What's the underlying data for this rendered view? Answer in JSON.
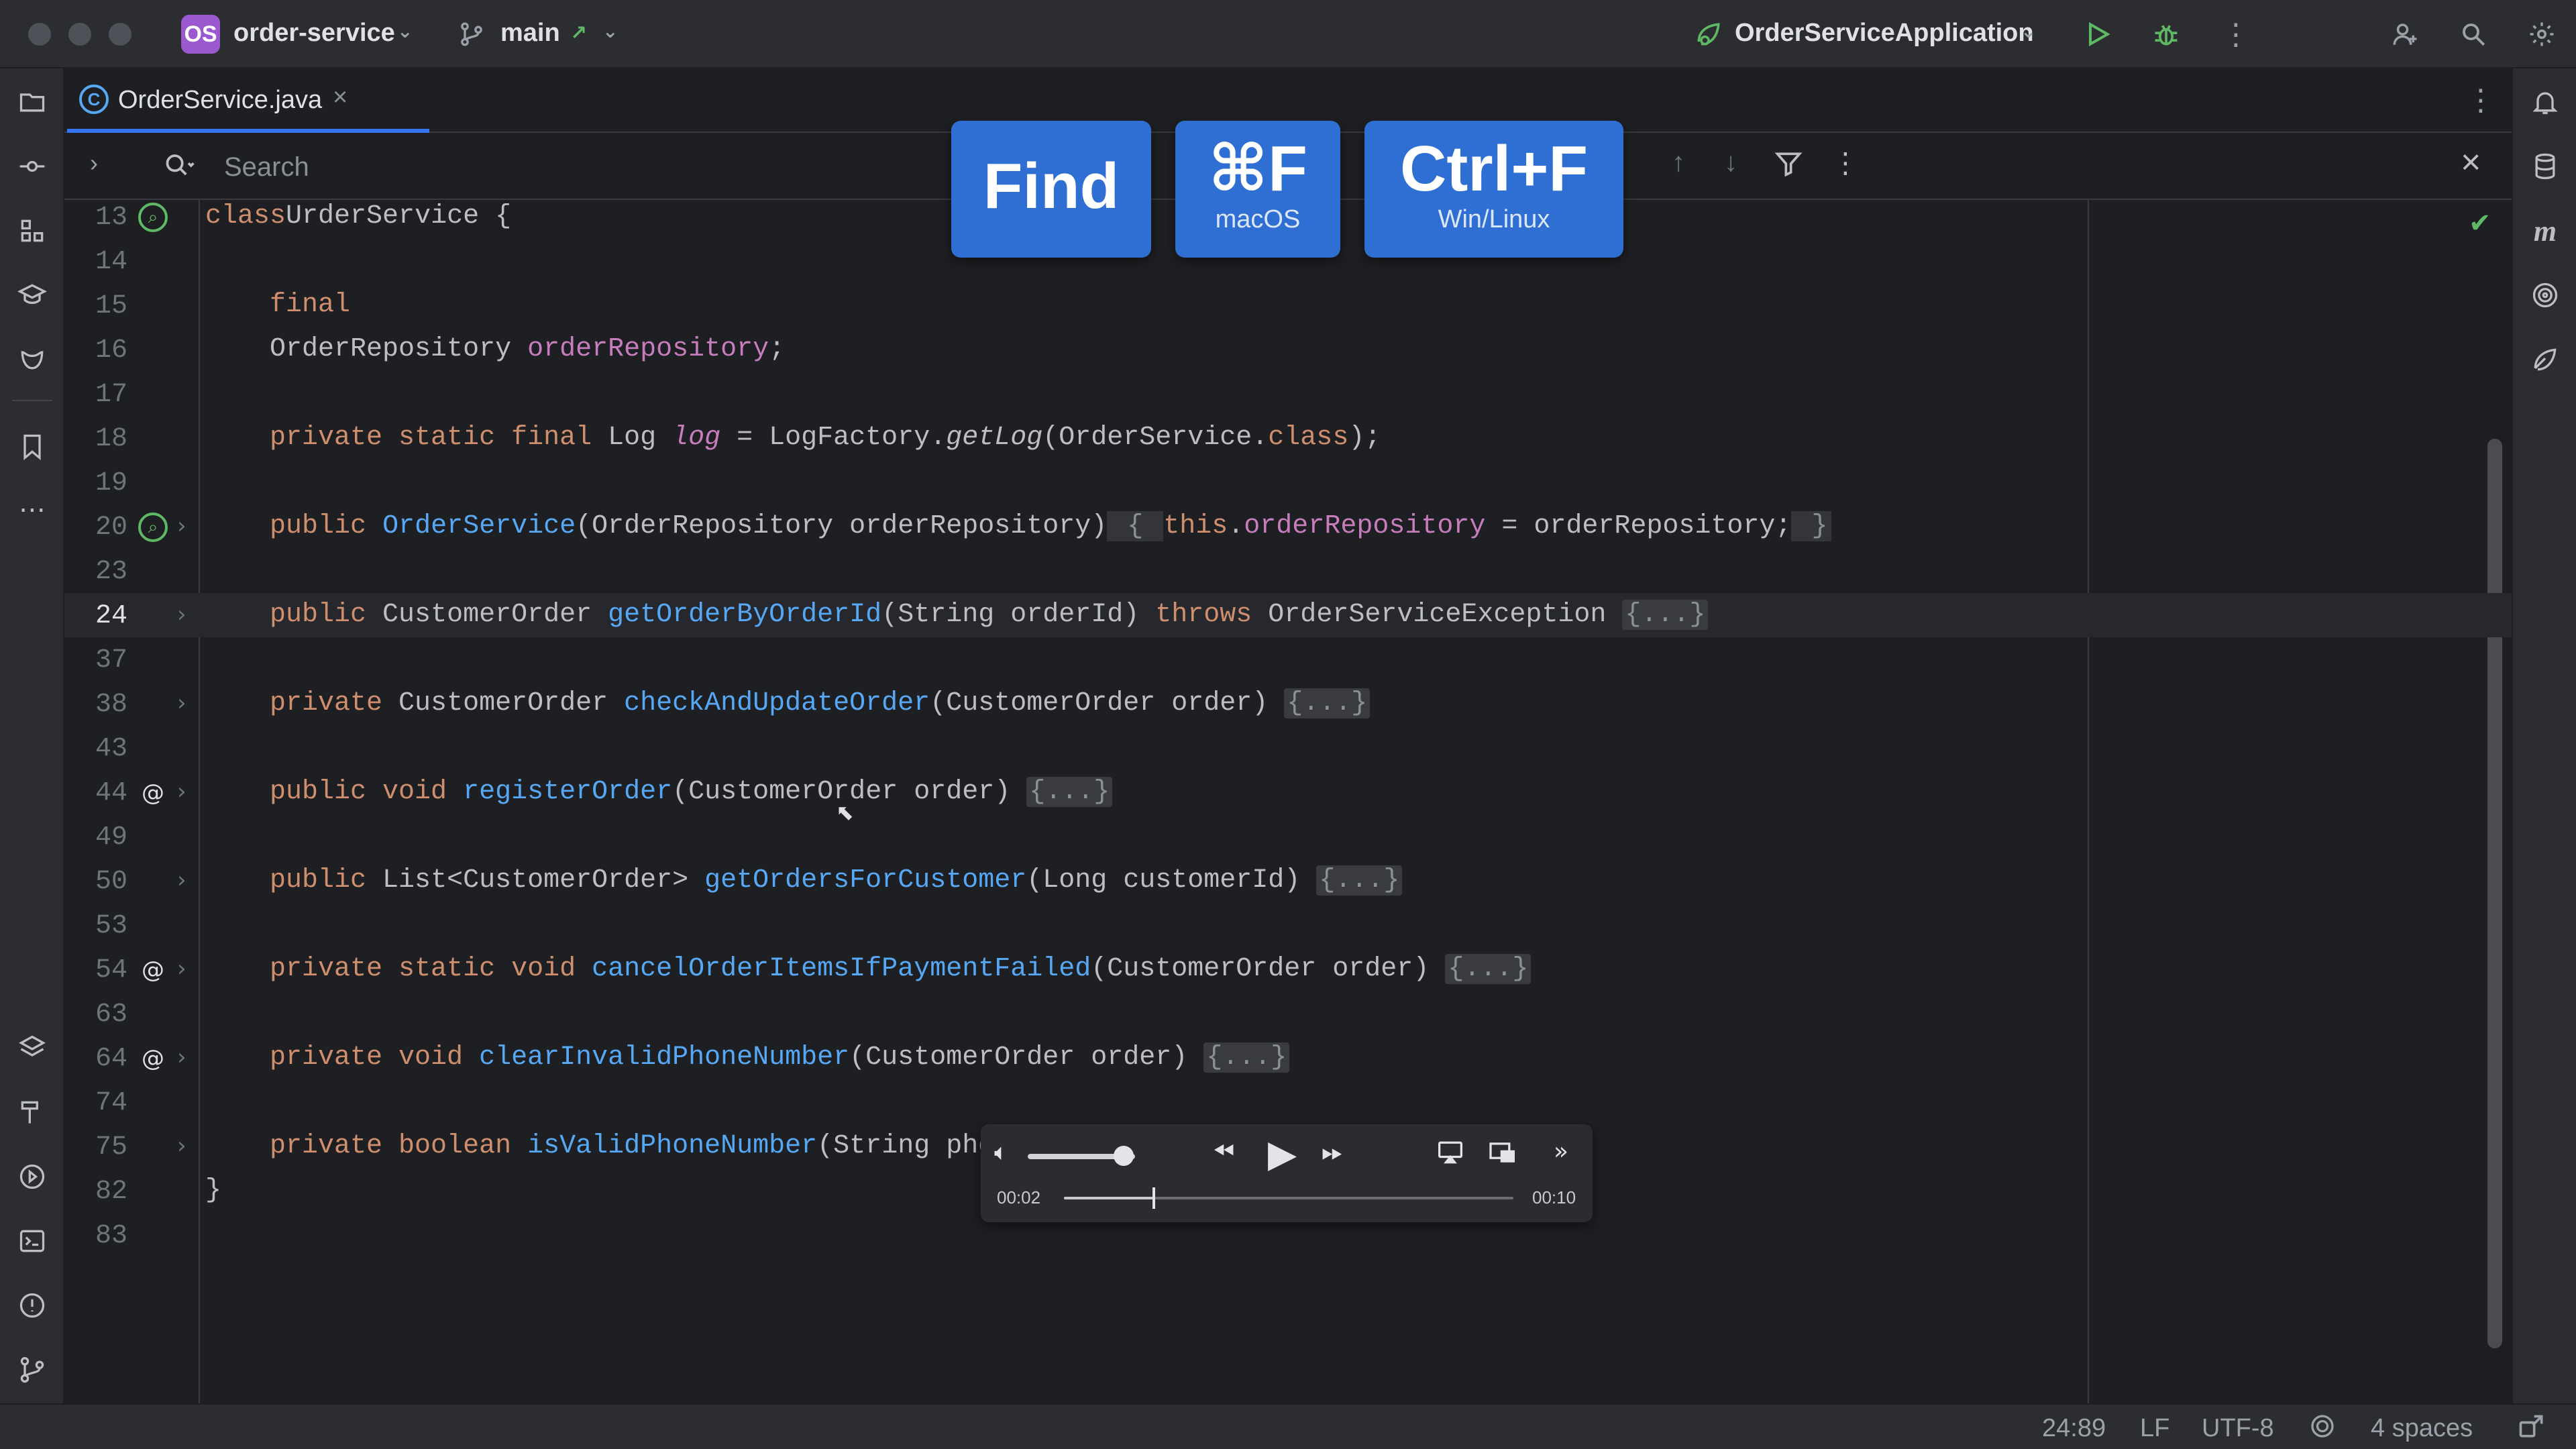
{
  "titlebar": {
    "project_badge": "OS",
    "project_name": "order-service",
    "branch": "main",
    "run_config": "OrderServiceApplication"
  },
  "editor": {
    "tab_label": "OrderService.java",
    "search_placeholder": "Search"
  },
  "code": [
    {
      "ln": "13",
      "tokens": [
        [
          "kw",
          "class"
        ],
        [
          "",
          "UrderService {"
        ]
      ],
      "gutter": "bean",
      "partial": true
    },
    {
      "ln": "14",
      "tokens": []
    },
    {
      "ln": "15",
      "tokens": [
        [
          "",
          "    "
        ],
        [
          "kw",
          "final"
        ]
      ]
    },
    {
      "ln": "16",
      "tokens": [
        [
          "",
          "    OrderRepository "
        ],
        [
          "fld",
          "orderRepository"
        ],
        [
          "",
          ";"
        ]
      ]
    },
    {
      "ln": "17",
      "tokens": []
    },
    {
      "ln": "18",
      "tokens": [
        [
          "",
          "    "
        ],
        [
          "kw",
          "private static final"
        ],
        [
          "",
          " Log "
        ],
        [
          "itfld",
          "log"
        ],
        [
          "",
          " = LogFactory."
        ],
        [
          "it",
          "getLog"
        ],
        [
          "",
          "(OrderService."
        ],
        [
          "kw",
          "class"
        ],
        [
          "",
          ");"
        ]
      ]
    },
    {
      "ln": "19",
      "tokens": []
    },
    {
      "ln": "20",
      "tokens": [
        [
          "",
          "    "
        ],
        [
          "kw",
          "public"
        ],
        [
          "",
          " "
        ],
        [
          "fn",
          "OrderService"
        ],
        [
          "",
          "(OrderRepository orderRepository)"
        ],
        [
          "brace",
          " { "
        ],
        [
          "kw",
          "this"
        ],
        [
          "",
          "."
        ],
        [
          "fld",
          "orderRepository"
        ],
        [
          "",
          " = orderRepository;"
        ],
        [
          "brace",
          " }"
        ]
      ],
      "gutter": "bean",
      "fold": true
    },
    {
      "ln": "23",
      "tokens": []
    },
    {
      "ln": "24",
      "tokens": [
        [
          "",
          "    "
        ],
        [
          "kw",
          "public"
        ],
        [
          "",
          " CustomerOrder "
        ],
        [
          "fn",
          "getOrderByOrderId"
        ],
        [
          "",
          "(String orderId) "
        ],
        [
          "kw",
          "throws"
        ],
        [
          "",
          " OrderServiceException "
        ],
        [
          "foldbox",
          "{...}"
        ]
      ],
      "fold": true,
      "current": true
    },
    {
      "ln": "37",
      "tokens": []
    },
    {
      "ln": "38",
      "tokens": [
        [
          "",
          "    "
        ],
        [
          "kw",
          "private"
        ],
        [
          "",
          " CustomerOrder "
        ],
        [
          "fn",
          "checkAndUpdateOrder"
        ],
        [
          "",
          "(CustomerOrder order) "
        ],
        [
          "foldbox",
          "{...}"
        ]
      ],
      "fold": true
    },
    {
      "ln": "43",
      "tokens": []
    },
    {
      "ln": "44",
      "tokens": [
        [
          "",
          "    "
        ],
        [
          "kw",
          "public void"
        ],
        [
          "",
          " "
        ],
        [
          "fn",
          "registerOrder"
        ],
        [
          "",
          "(CustomerOrder order) "
        ],
        [
          "foldbox",
          "{...}"
        ]
      ],
      "fold": true,
      "gutter": "at"
    },
    {
      "ln": "49",
      "tokens": []
    },
    {
      "ln": "50",
      "tokens": [
        [
          "",
          "    "
        ],
        [
          "kw",
          "public"
        ],
        [
          "",
          " List<CustomerOrder> "
        ],
        [
          "fn",
          "getOrdersForCustomer"
        ],
        [
          "",
          "(Long customerId) "
        ],
        [
          "foldbox",
          "{...}"
        ]
      ],
      "fold": true
    },
    {
      "ln": "53",
      "tokens": []
    },
    {
      "ln": "54",
      "tokens": [
        [
          "",
          "    "
        ],
        [
          "kw",
          "private static void"
        ],
        [
          "",
          " "
        ],
        [
          "fn",
          "cancelOrderItemsIfPaymentFailed"
        ],
        [
          "",
          "(CustomerOrder order) "
        ],
        [
          "foldbox",
          "{...}"
        ]
      ],
      "fold": true,
      "gutter": "at"
    },
    {
      "ln": "63",
      "tokens": []
    },
    {
      "ln": "64",
      "tokens": [
        [
          "",
          "    "
        ],
        [
          "kw",
          "private void"
        ],
        [
          "",
          " "
        ],
        [
          "fn",
          "clearInvalidPhoneNumber"
        ],
        [
          "",
          "(CustomerOrder order) "
        ],
        [
          "foldbox",
          "{...}"
        ]
      ],
      "fold": true,
      "gutter": "at"
    },
    {
      "ln": "74",
      "tokens": []
    },
    {
      "ln": "75",
      "tokens": [
        [
          "",
          "    "
        ],
        [
          "kw",
          "private boolean"
        ],
        [
          "",
          " "
        ],
        [
          "fn",
          "isValidPhoneNumber"
        ],
        [
          "",
          "(String phor"
        ]
      ],
      "fold": true
    },
    {
      "ln": "82",
      "tokens": [
        [
          "",
          "}"
        ]
      ]
    },
    {
      "ln": "83",
      "tokens": []
    }
  ],
  "shortcut_overlay": {
    "find_label": "Find",
    "mac_key": "⌘F",
    "mac_label": "macOS",
    "win_key": "Ctrl+F",
    "win_label": "Win/Linux"
  },
  "media_player": {
    "current_time": "00:02",
    "total_time": "00:10",
    "volume": 0.75,
    "progress": 0.2
  },
  "statusbar": {
    "position": "24:89",
    "line_separator": "LF",
    "encoding": "UTF-8",
    "indent": "4 spaces"
  },
  "icons": {
    "colors": {
      "accent": "#3574f0",
      "run": "#5fb865",
      "badge": "#9b59d0"
    }
  }
}
